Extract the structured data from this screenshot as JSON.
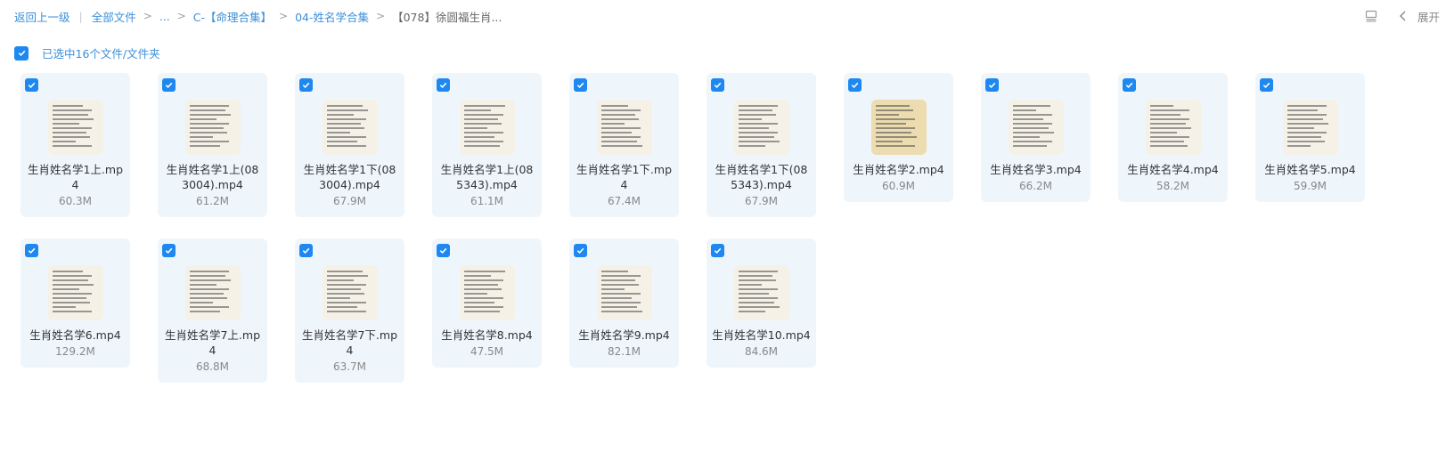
{
  "breadcrumb": {
    "back_label": "返回上一级",
    "all_files_label": "全部文件",
    "ellipsis": "...",
    "folder1": "C-【命理合集】",
    "folder2": "04-姓名学合集",
    "current": "【078】徐圆福生肖..."
  },
  "toolbar": {
    "expand_label": "展开"
  },
  "selection": {
    "label": "已选中16个文件/文件夹",
    "checked": true
  },
  "files": [
    {
      "name": "生肖姓名学1上.mp4",
      "size": "60.3M"
    },
    {
      "name": "生肖姓名学1上(083004).mp4",
      "size": "61.2M"
    },
    {
      "name": "生肖姓名学1下(083004).mp4",
      "size": "67.9M"
    },
    {
      "name": "生肖姓名学1上(085343).mp4",
      "size": "61.1M"
    },
    {
      "name": "生肖姓名学1下.mp4",
      "size": "67.4M"
    },
    {
      "name": "生肖姓名学1下(085343).mp4",
      "size": "67.9M"
    },
    {
      "name": "生肖姓名学2.mp4",
      "size": "60.9M"
    },
    {
      "name": "生肖姓名学3.mp4",
      "size": "66.2M"
    },
    {
      "name": "生肖姓名学4.mp4",
      "size": "58.2M"
    },
    {
      "name": "生肖姓名学5.mp4",
      "size": "59.9M"
    },
    {
      "name": "生肖姓名学6.mp4",
      "size": "129.2M"
    },
    {
      "name": "生肖姓名学7上.mp4",
      "size": "68.8M"
    },
    {
      "name": "生肖姓名学7下.mp4",
      "size": "63.7M"
    },
    {
      "name": "生肖姓名学8.mp4",
      "size": "47.5M"
    },
    {
      "name": "生肖姓名学9.mp4",
      "size": "82.1M"
    },
    {
      "name": "生肖姓名学10.mp4",
      "size": "84.6M"
    }
  ],
  "icons": {
    "checkbox": "checkbox-checked-icon",
    "list_view": "list-view-icon",
    "expand": "chevron-left-icon",
    "thumbnail": "video-thumbnail-icon"
  },
  "colors": {
    "accent": "#1e88f0",
    "link": "#3b8fd9",
    "card_bg": "#eef6fc"
  }
}
